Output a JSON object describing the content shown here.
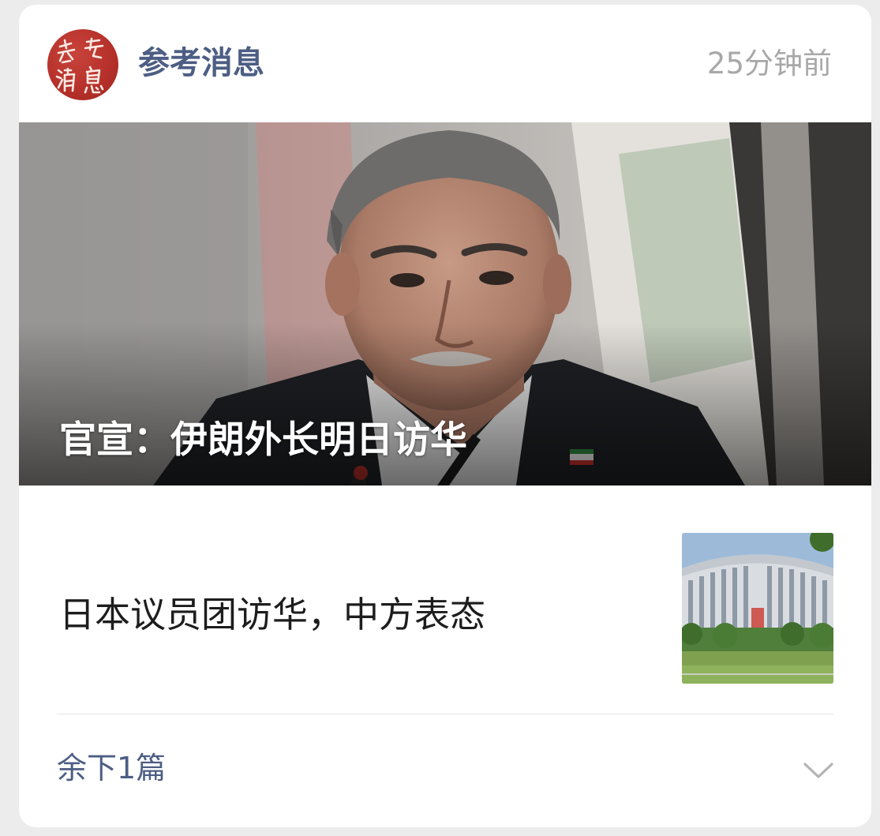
{
  "header": {
    "account_name": "参考消息",
    "time": "25分钟前",
    "avatar_icon": "cankao-xiaoxi-logo-icon",
    "avatar_color": "#b5302a"
  },
  "main_article": {
    "title": "官宣：伊朗外长明日访华",
    "image_icon": "portrait-photo"
  },
  "articles": [
    {
      "title": "日本议员团访华，中方表态",
      "thumbnail_icon": "building-photo"
    }
  ],
  "footer": {
    "more_label": "余下1篇",
    "expand_icon": "chevron-down-icon"
  },
  "colors": {
    "account_name": "#4d5e84",
    "time": "#a8a8a8",
    "title": "#1d1d1d"
  }
}
